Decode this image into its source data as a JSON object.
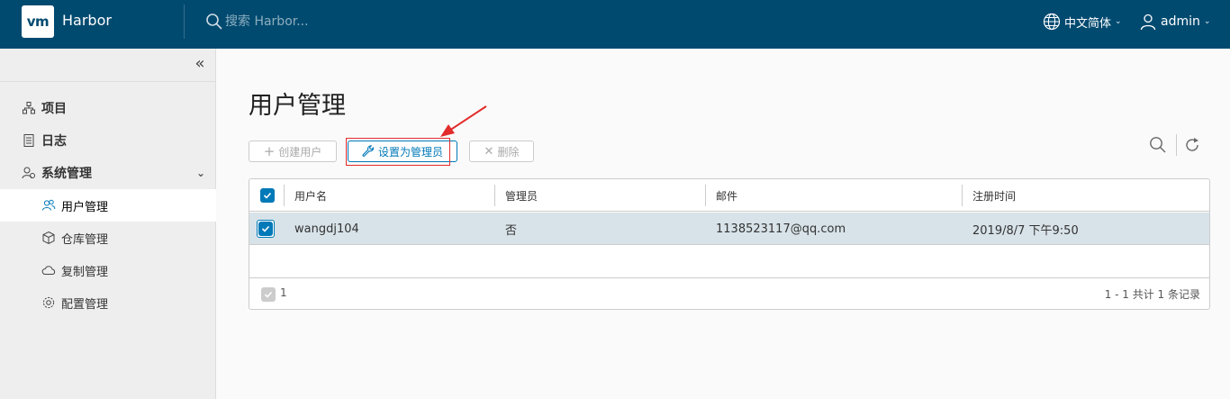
{
  "header": {
    "logo_text": "vm",
    "app_title": "Harbor",
    "search_placeholder": "搜索 Harbor...",
    "language": "中文简体",
    "user": "admin"
  },
  "sidebar": {
    "items": [
      {
        "label": "项目",
        "icon": "projects-icon"
      },
      {
        "label": "日志",
        "icon": "logs-icon"
      },
      {
        "label": "系统管理",
        "icon": "admin-icon",
        "expanded": true
      }
    ],
    "sub_items": [
      {
        "label": "用户管理",
        "icon": "users-icon",
        "active": true
      },
      {
        "label": "仓库管理",
        "icon": "registry-icon"
      },
      {
        "label": "复制管理",
        "icon": "replication-icon"
      },
      {
        "label": "配置管理",
        "icon": "config-icon"
      }
    ]
  },
  "main": {
    "title": "用户管理",
    "toolbar": {
      "create_label": "创建用户",
      "set_admin_label": "设置为管理员",
      "delete_label": "删除"
    },
    "table": {
      "columns": [
        "用户名",
        "管理员",
        "邮件",
        "注册时间"
      ],
      "rows": [
        {
          "username": "wangdj104",
          "admin": "否",
          "email": "1138523117@qq.com",
          "registered": "2019/8/7 下午9:50",
          "selected": true
        }
      ],
      "footer_selected": "1",
      "footer_total": "1 - 1 共计 1 条记录"
    }
  },
  "colors": {
    "header_bg": "#004a70",
    "accent": "#0079b8",
    "highlight_annotation": "#e32b2b",
    "selected_row": "#d8e3e9"
  }
}
